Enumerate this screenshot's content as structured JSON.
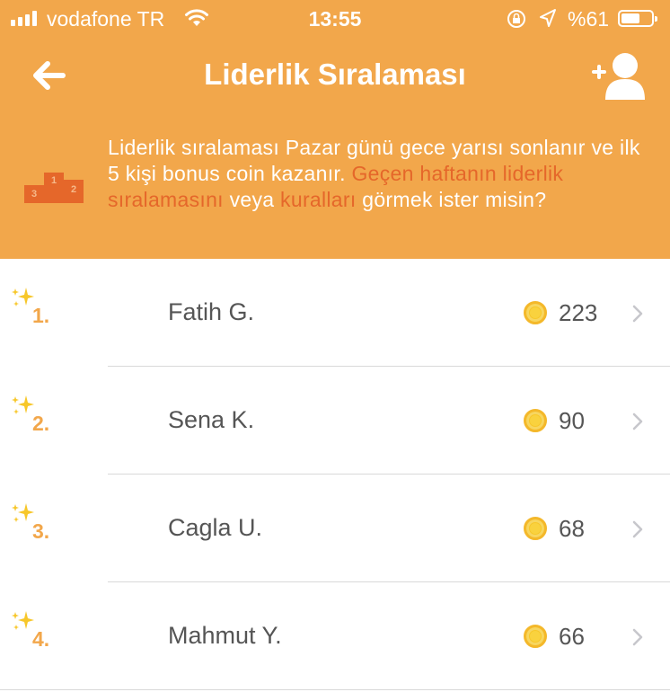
{
  "status_bar": {
    "carrier": "vodafone TR",
    "time": "13:55",
    "battery_text": "%61",
    "battery_level": 0.61
  },
  "nav": {
    "title": "Liderlik Sıralaması",
    "back_icon": "arrow-left-icon",
    "add_friend_icon": "add-user-icon"
  },
  "banner": {
    "icon": "podium-icon",
    "text_part1": "Liderlik sıralaması Pazar günü gece yarısı sonlanır ve ilk 5 kişi bonus coin kazanır. ",
    "link_last_week": "Geçen haftanın liderlik sıralamasını",
    "text_part2": " veya ",
    "link_rules": "kuralları",
    "text_part3": " görmek ister misin?",
    "podium_labels": [
      "1",
      "2",
      "3"
    ]
  },
  "leaderboard": [
    {
      "rank": "1.",
      "name": "Fatih G.",
      "score": "223"
    },
    {
      "rank": "2.",
      "name": "Sena K.",
      "score": "90"
    },
    {
      "rank": "3.",
      "name": "Cagla U.",
      "score": "68"
    },
    {
      "rank": "4.",
      "name": "Mahmut Y.",
      "score": "66"
    }
  ],
  "colors": {
    "header_bg": "#F2A74B",
    "link": "#E5672A",
    "rank": "#F2A74B",
    "coin": "#F7C72A"
  }
}
